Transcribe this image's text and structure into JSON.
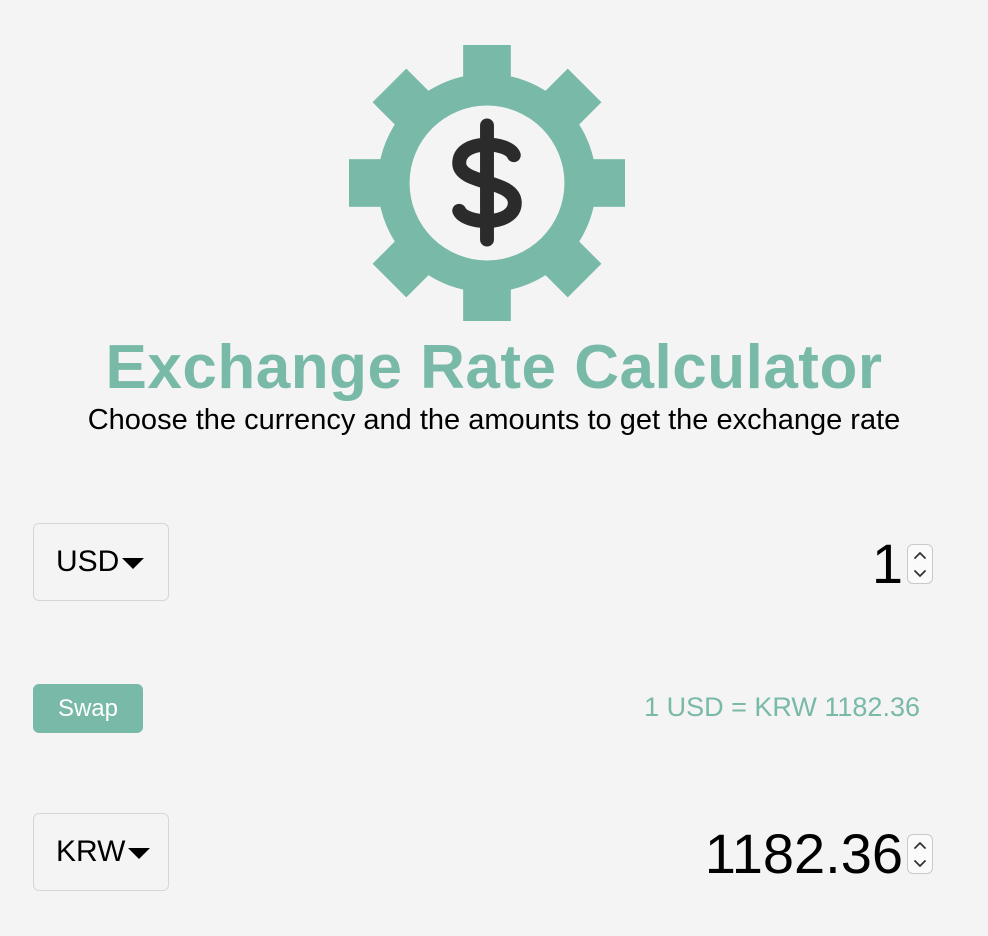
{
  "header": {
    "title": "Exchange Rate Calculator",
    "subtitle": "Choose the currency and the amounts to get the exchange rate",
    "logo_icon": "gear-dollar-icon"
  },
  "currency_one": {
    "selected": "USD",
    "amount": "1"
  },
  "currency_two": {
    "selected": "KRW",
    "amount": "1182.36"
  },
  "swap": {
    "label": "Swap"
  },
  "rate": {
    "text": "1 USD = KRW 1182.36"
  },
  "colors": {
    "accent": "#78b9a8",
    "background": "#f4f4f4",
    "text": "#000000",
    "dollar_sign": "#2b2b2b"
  }
}
